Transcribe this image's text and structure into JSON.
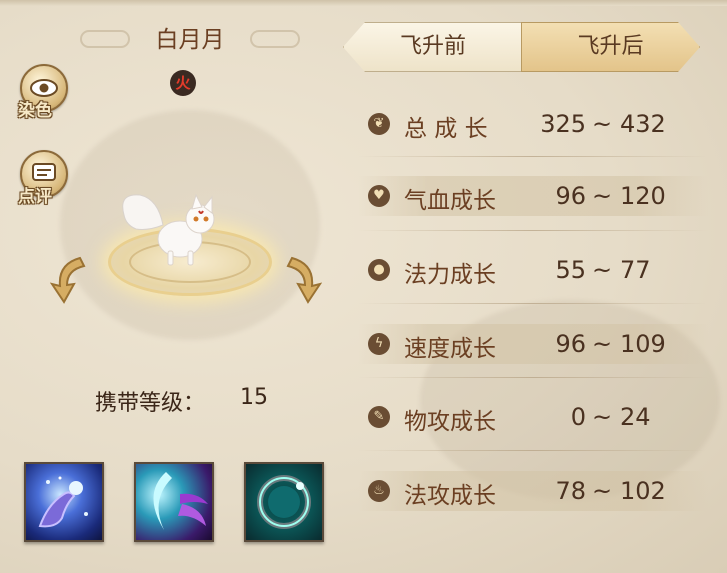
{
  "pet": {
    "name": "白月月",
    "element": "火",
    "carry_level_label": "携带等级：",
    "carry_level_value": "15"
  },
  "side_buttons": {
    "dye_label": "染色",
    "review_label": "点评"
  },
  "tabs": {
    "before_label": "飞升前",
    "after_label": "飞升后",
    "selected": "飞升后"
  },
  "stats": [
    {
      "label": "总 成 长",
      "min": "325",
      "sep": "~",
      "max": "432",
      "icon": "sprout-icon"
    },
    {
      "label": "气血成长",
      "min": "96",
      "sep": "~",
      "max": "120",
      "icon": "heart-icon"
    },
    {
      "label": "法力成长",
      "min": "55",
      "sep": "~",
      "max": "77",
      "icon": "drop-icon"
    },
    {
      "label": "速度成长",
      "min": "96",
      "sep": "~",
      "max": "109",
      "icon": "lightning-icon"
    },
    {
      "label": "物攻成长",
      "min": "0",
      "sep": "~",
      "max": "24",
      "icon": "sword-icon"
    },
    {
      "label": "法攻成长",
      "min": "78",
      "sep": "~",
      "max": "102",
      "icon": "flame-icon"
    }
  ],
  "skills": [
    {
      "icon": "magic-hand-skill-icon"
    },
    {
      "icon": "claw-crescent-skill-icon"
    },
    {
      "icon": "ring-orb-skill-icon"
    }
  ],
  "colors": {
    "background": "#e6dcc8",
    "text_brown": "#6b3f22",
    "tab_active": "#e3c48a",
    "element_fire": "#e43b2a"
  }
}
